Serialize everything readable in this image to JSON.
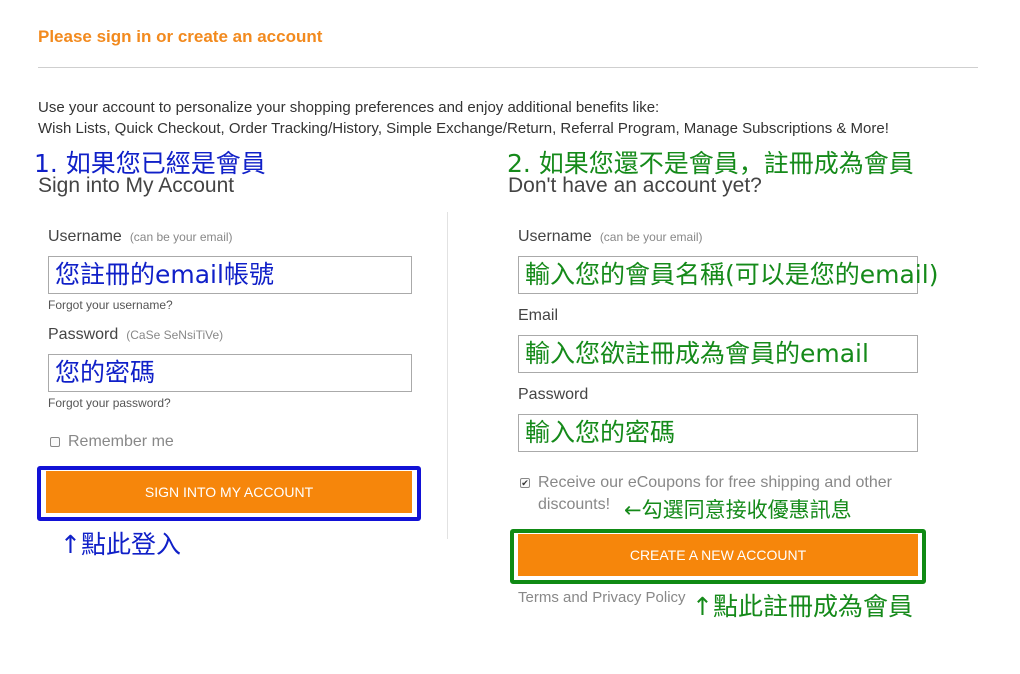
{
  "header": {
    "title": "Please sign in or create an account"
  },
  "intro": {
    "line1": "Use your account to personalize your shopping preferences and enjoy additional benefits like:",
    "line2": "Wish Lists, Quick Checkout, Order Tracking/History, Simple Exchange/Return, Referral Program, Manage Subscriptions & More!"
  },
  "signin": {
    "annotation": "1. 如果您已經是會員",
    "title": "Sign into My Account",
    "username_label": "Username",
    "username_hint": "(can be your email)",
    "username_value": "您註冊的email帳號",
    "forgot_username": "Forgot your username?",
    "password_label": "Password",
    "password_hint": "(CaSe SeNsiTiVe)",
    "password_value": "您的密碼",
    "forgot_password": "Forgot your password?",
    "remember_label": "Remember me",
    "remember_checked": false,
    "button_label": "SIGN INTO MY ACCOUNT",
    "button_annotation": "↑點此登入"
  },
  "register": {
    "annotation": "2. 如果您還不是會員，註冊成為會員",
    "title": "Don't have an account yet?",
    "username_label": "Username",
    "username_hint": "(can be your email)",
    "username_value": "輸入您的會員名稱(可以是您的email)",
    "email_label": "Email",
    "email_value": "輸入您欲註冊成為會員的email",
    "password_label": "Password",
    "password_value": "輸入您的密碼",
    "coupon_label_line1": "Receive our eCoupons for free shipping and other",
    "coupon_label_line2": "discounts!",
    "coupon_checked": true,
    "coupon_annotation": "←勾選同意接收優惠訊息",
    "button_label": "CREATE A NEW ACCOUNT",
    "terms_link": "Terms and Privacy Policy",
    "button_annotation": "↑點此註冊成為會員"
  },
  "colors": {
    "accent_orange": "#f6860b",
    "annotation_blue": "#1020c8",
    "annotation_green": "#158a1a"
  }
}
